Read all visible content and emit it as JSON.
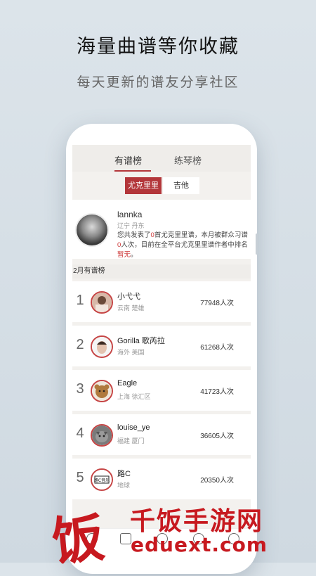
{
  "promo": {
    "headline": "海量曲谱等你收藏",
    "subline": "每天更新的谱友分享社区"
  },
  "tabs": {
    "active": "有谱榜",
    "inactive": "练琴榜"
  },
  "segments": {
    "active": "尤克里里",
    "inactive": "吉他"
  },
  "profile": {
    "name": "lannka",
    "location": "辽宁 丹东",
    "desc_1": "您共发表了",
    "count_published": "0",
    "desc_2": "首尤克里里谱，本月被群众习谱",
    "count_practiced": "0",
    "desc_3": "人次，目前在全平台尤克里里谱作者中排名",
    "rank": "暂无",
    "desc_4": "。"
  },
  "section_title": "2月有谱榜",
  "ranking": [
    {
      "rank": "1",
      "name": "小弋弋",
      "location": "云南 楚雄",
      "count": "77948人次"
    },
    {
      "rank": "2",
      "name": "Gorilla 歌芮拉",
      "location": "海外 美国",
      "count": "61268人次"
    },
    {
      "rank": "3",
      "name": "Eagle",
      "location": "上海 徐汇区",
      "count": "41723人次"
    },
    {
      "rank": "4",
      "name": "louise_ye",
      "location": "福建 厦门",
      "count": "36605人次"
    },
    {
      "rank": "5",
      "name": "路C",
      "location": "地球",
      "count": "20350人次"
    }
  ],
  "avatar_texts": {
    "rank5": "路C音乐"
  },
  "watermark": {
    "logo": "饭",
    "title": "千饭手游网",
    "url": "eduext.com"
  },
  "colors": {
    "accent": "#b3363a",
    "watermark": "#c7191f"
  }
}
